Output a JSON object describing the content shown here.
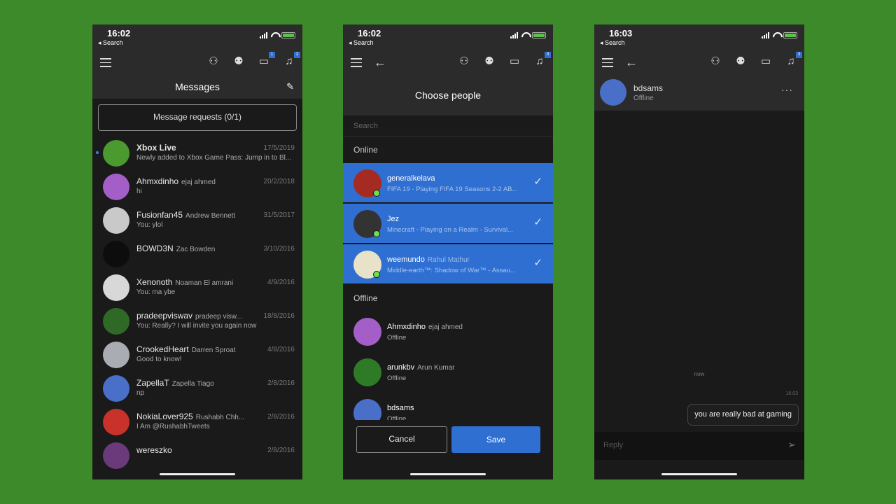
{
  "background_color": "#3d8a2a",
  "accent_color": "#2f6fd1",
  "panels": [
    {
      "status": {
        "time": "16:02",
        "back_label": "◂ Search"
      },
      "nav": {
        "badges": {
          "messages": "1",
          "notifications": "2"
        }
      },
      "title": "Messages",
      "message_requests_label": "Message requests (0/1)",
      "conversations": [
        {
          "gamertag": "Xbox Live",
          "real_name": "",
          "date": "17/5/2019",
          "preview": "Newly added to Xbox Game Pass: Jump in to Bl...",
          "unread": true,
          "avatar_color": "#4a9a2f"
        },
        {
          "gamertag": "Ahmxdinho",
          "real_name": "ejaj ahmed",
          "date": "20/2/2018",
          "preview": "hi",
          "avatar_color": "#a45ec8"
        },
        {
          "gamertag": "Fusionfan45",
          "real_name": "Andrew Bennett",
          "date": "31/5/2017",
          "preview": "You: ylol",
          "avatar_color": "#c9c9c9"
        },
        {
          "gamertag": "BOWD3N",
          "real_name": "Zac Bowden",
          "date": "3/10/2016",
          "preview": "",
          "avatar_color": "#0d0d0d"
        },
        {
          "gamertag": "Xenonoth",
          "real_name": "Noaman El amrani",
          "date": "4/9/2016",
          "preview": "You: ma ybe",
          "avatar_color": "#d8d8d8"
        },
        {
          "gamertag": "pradeepviswav",
          "real_name": "pradeep visw...",
          "date": "18/8/2016",
          "preview": "You: Really? I will invite you again now",
          "avatar_color": "#2e6a26"
        },
        {
          "gamertag": "CrookedHeart",
          "real_name": "Darren Sproat",
          "date": "4/8/2016",
          "preview": "Good to know!",
          "avatar_color": "#a9adb3"
        },
        {
          "gamertag": "ZapellaT",
          "real_name": "Zapella Tiago",
          "date": "2/8/2016",
          "preview": "np",
          "avatar_color": "#4a6fc9"
        },
        {
          "gamertag": "NokiaLover925",
          "real_name": "Rushabh Chh...",
          "date": "2/8/2016",
          "preview": "I Am @RushabhTweets",
          "avatar_color": "#c8322a"
        },
        {
          "gamertag": "wereszko",
          "real_name": "",
          "date": "2/8/2016",
          "preview": "",
          "avatar_color": "#6a3a7a"
        }
      ]
    },
    {
      "status": {
        "time": "16:02",
        "back_label": "◂ Search"
      },
      "nav": {
        "badges": {
          "notifications": "3"
        }
      },
      "title": "Choose people",
      "search_placeholder": "Search",
      "online_label": "Online",
      "offline_label": "Offline",
      "online": [
        {
          "gamertag": "generalkelava",
          "real_name": "",
          "activity": "FIFA 19 - Playing FIFA 19 Seasons 2-2 AB...",
          "selected": true,
          "avatar_color": "#a52a22"
        },
        {
          "gamertag": "Jez",
          "real_name": "",
          "activity": "Minecraft - Playing on a Realm - Survival...",
          "selected": true,
          "avatar_color": "#333333"
        },
        {
          "gamertag": "weemundo",
          "real_name": "Rahul Mathur",
          "activity": "Middle-earth™: Shadow of War™ - Assau...",
          "selected": true,
          "avatar_color": "#e8e2c8"
        }
      ],
      "offline": [
        {
          "gamertag": "Ahmxdinho",
          "real_name": "ejaj ahmed",
          "status": "Offline",
          "avatar_color": "#a45ec8"
        },
        {
          "gamertag": "arunkbv",
          "real_name": "Arun Kumar",
          "status": "Offline",
          "avatar_color": "#2e7a26"
        },
        {
          "gamertag": "bdsams",
          "real_name": "",
          "status": "Offline",
          "avatar_color": "#4a6fc9"
        }
      ],
      "cancel_label": "Cancel",
      "save_label": "Save"
    },
    {
      "status": {
        "time": "16:03",
        "back_label": "◂ Search"
      },
      "nav": {
        "badges": {
          "notifications": "3"
        }
      },
      "contact": {
        "gamertag": "bdsams",
        "status": "Offline",
        "avatar_color": "#4a6fc9"
      },
      "more_label": "···",
      "divider_label": "now",
      "message_time": "16:03",
      "message_text": "you are really bad at gaming",
      "reply_placeholder": "Reply"
    }
  ],
  "icons": {
    "friends": "friends-icon",
    "party": "party-icon",
    "messages": "messages-icon",
    "notifications": "bell-icon",
    "compose": "compose-icon",
    "send": "send-icon"
  }
}
